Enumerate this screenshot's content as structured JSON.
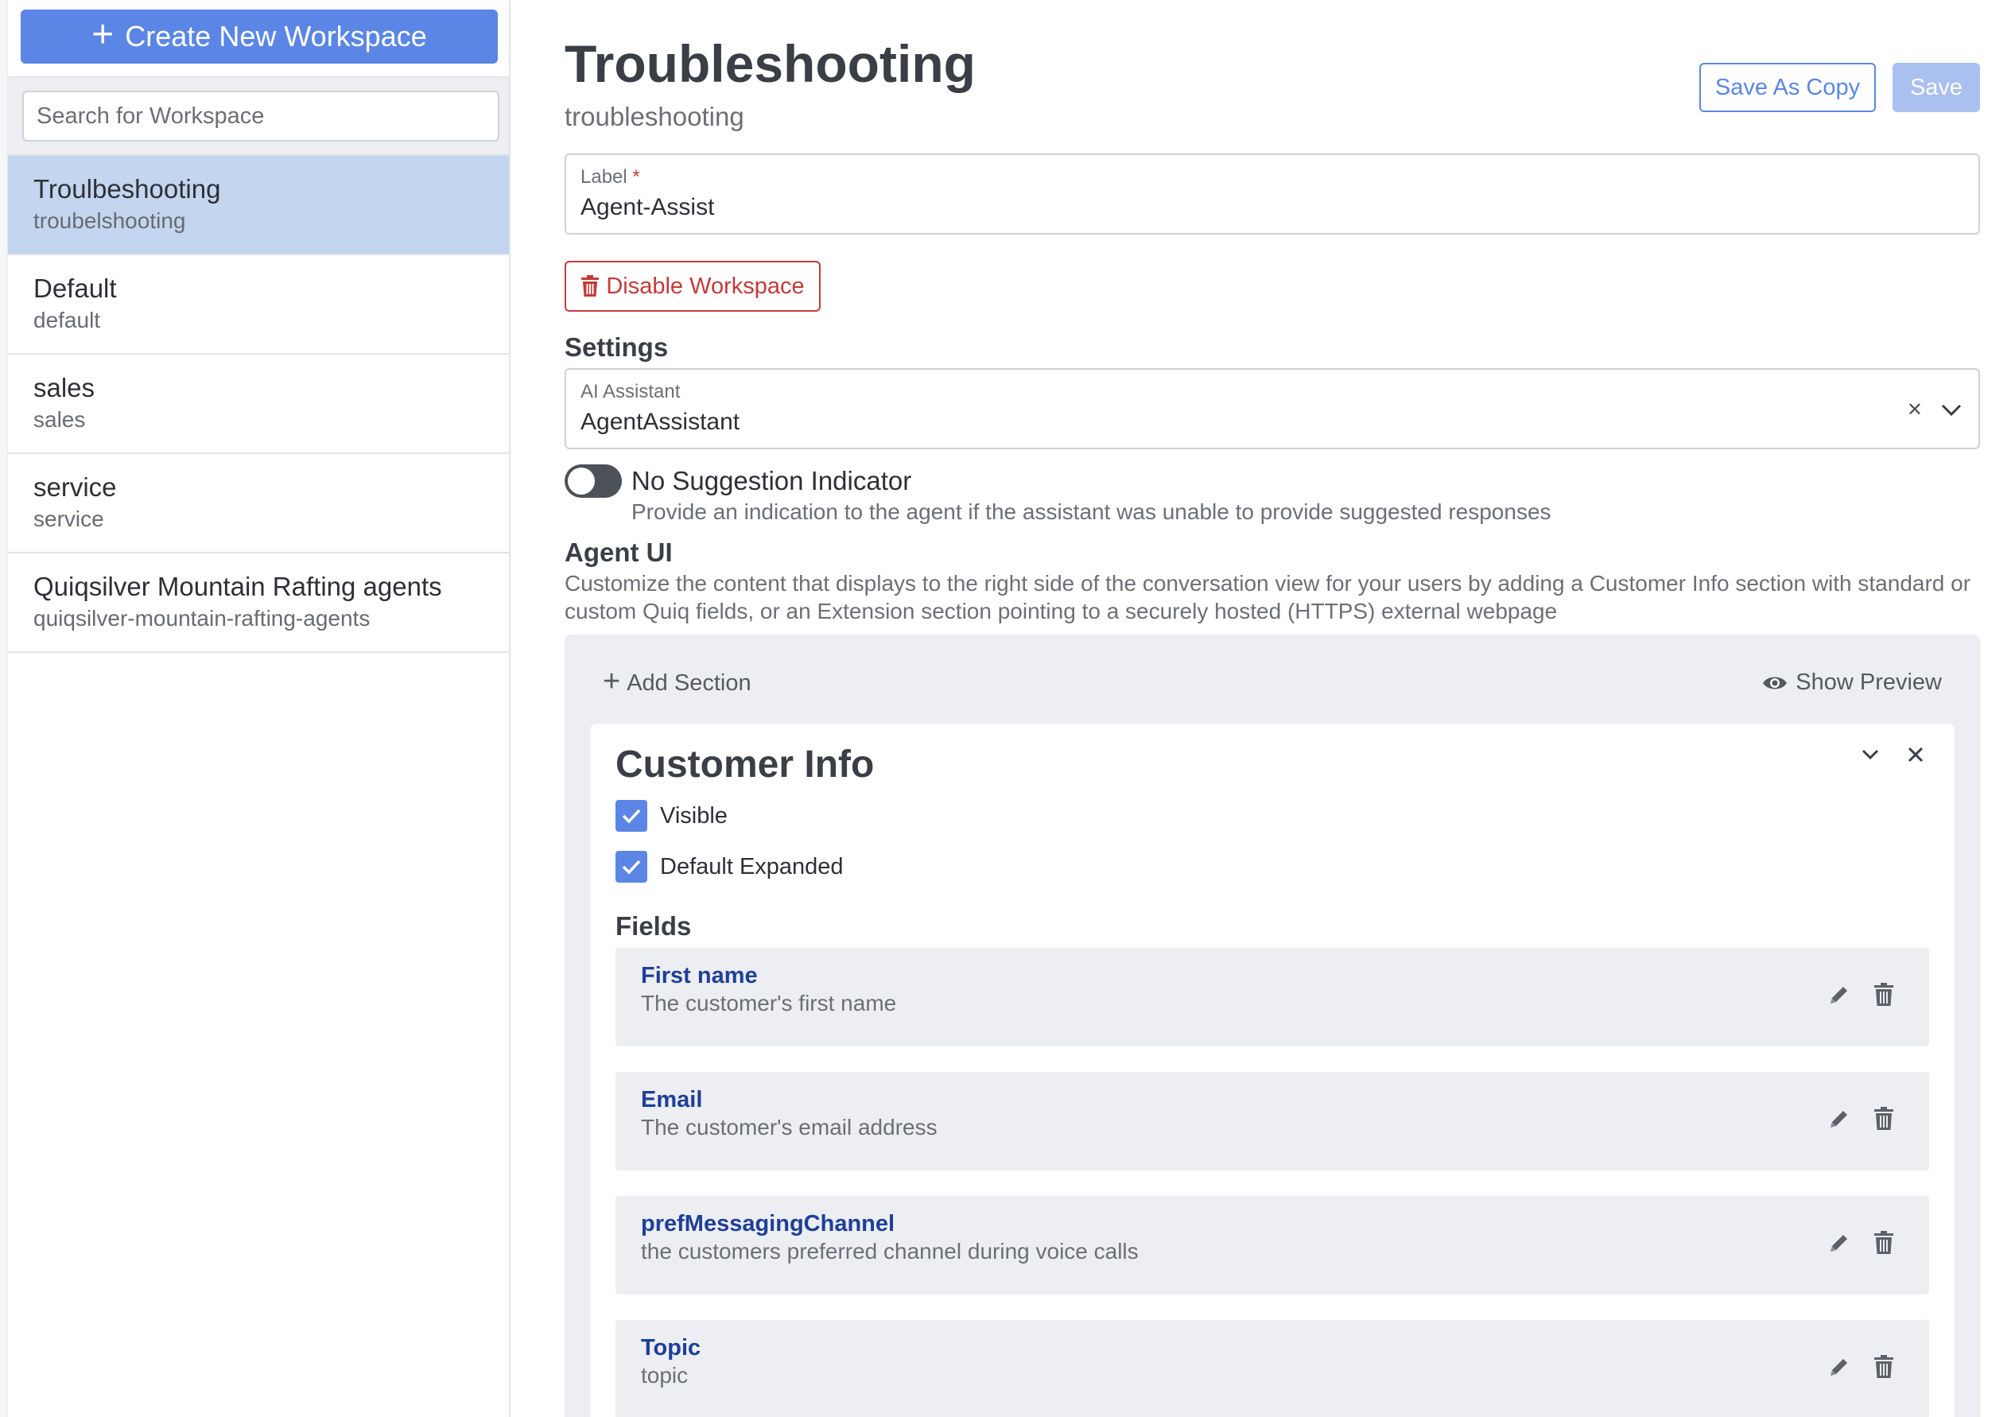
{
  "sidebar": {
    "create_label": "Create New Workspace",
    "search_placeholder": "Search for Workspace",
    "workspaces": [
      {
        "label": "Troulbeshooting",
        "name": "troubelshooting"
      },
      {
        "label": "Default",
        "name": "default"
      },
      {
        "label": "sales",
        "name": "sales"
      },
      {
        "label": "service",
        "name": "service"
      },
      {
        "label": "Quiqsilver Mountain Rafting agents",
        "name": "quiqsilver-mountain-rafting-agents"
      }
    ]
  },
  "header": {
    "title": "Troubleshooting",
    "subtitle": "troubleshooting",
    "save_as_copy": "Save As Copy",
    "save": "Save"
  },
  "label_field": {
    "caption": "Label",
    "required_mark": "*",
    "value": "Agent-Assist"
  },
  "disable_button": "Disable Workspace",
  "settings": {
    "title": "Settings",
    "ai_assistant": {
      "caption": "AI Assistant",
      "value": "AgentAssistant"
    },
    "no_suggestion": {
      "label": "No Suggestion Indicator",
      "help": "Provide an indication to the agent if the assistant was unable to provide suggested responses",
      "enabled": false
    }
  },
  "agent_ui": {
    "title": "Agent UI",
    "description": "Customize the content that displays to the right side of the conversation view for your users by adding a Customer Info section with standard or custom Quiq fields, or an Extension section pointing to a securely hosted (HTTPS) external webpage",
    "add_section": "Add Section",
    "show_preview": "Show Preview",
    "section": {
      "title": "Customer Info",
      "visible_label": "Visible",
      "visible": true,
      "default_expanded_label": "Default Expanded",
      "default_expanded": true,
      "fields_title": "Fields",
      "fields": [
        {
          "name": "First name",
          "description": "The customer's first name"
        },
        {
          "name": "Email",
          "description": "The customer's email address"
        },
        {
          "name": "prefMessagingChannel",
          "description": "the customers preferred channel during voice calls"
        },
        {
          "name": "Topic",
          "description": "topic"
        }
      ]
    }
  },
  "colors": {
    "accent": "#5b86e5",
    "danger": "#c43a3a",
    "field_name": "#1e3f9a",
    "active_item": "#c3d5ef"
  }
}
